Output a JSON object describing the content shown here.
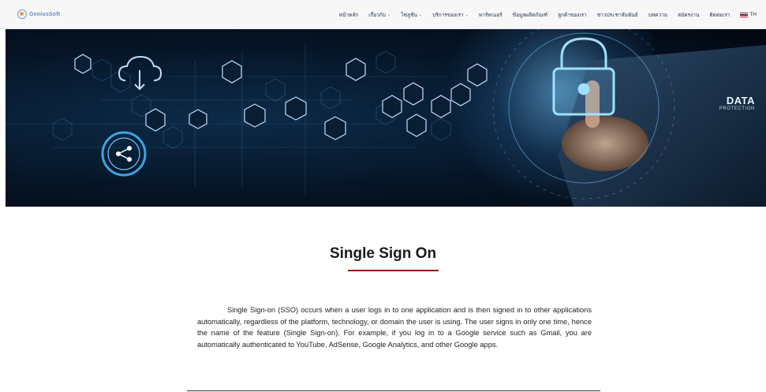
{
  "header": {
    "logo_text": "GeniusSoft",
    "nav": [
      {
        "label": "หน้าหลัก",
        "dropdown": false
      },
      {
        "label": "เกี่ยวกับ",
        "dropdown": true
      },
      {
        "label": "โซลูชั่น",
        "dropdown": true
      },
      {
        "label": "บริการของเรา",
        "dropdown": true
      },
      {
        "label": "พาร์ทเนอร์",
        "dropdown": false
      },
      {
        "label": "ข้อมูลผลิตภัณฑ์",
        "dropdown": false
      },
      {
        "label": "ลูกค้าของเรา",
        "dropdown": false
      },
      {
        "label": "ข่าวประชาสัมพันธ์",
        "dropdown": false
      },
      {
        "label": "บทความ",
        "dropdown": false
      },
      {
        "label": "สมัครงาน",
        "dropdown": false
      },
      {
        "label": "ติดต่อเรา",
        "dropdown": false
      }
    ],
    "language": "TH",
    "dropdown_caret": "⌄"
  },
  "hero": {
    "badge_title": "DATA",
    "badge_subtitle": "PROTECTION",
    "icons": [
      "folder-icon",
      "cloud-download-icon",
      "laptop-icon",
      "phone-call-icon",
      "document-icon",
      "server-icon",
      "video-icon",
      "mail-icon",
      "cloud-upload-icon",
      "browser-icon",
      "globe-icon",
      "lightbulb-icon",
      "bank-icon",
      "gear-icon",
      "share-icon",
      "lock-icon"
    ]
  },
  "content": {
    "title": "Single Sign On",
    "paragraph": "Single Sign-on (SSO) occurs when a user logs in to one application and is then signed in to other applications automatically, regardless of the platform, technology, or domain the user is using. The user signs in only one time, hence the name of the feature (Single Sign-on). For example, if you log in to a Google service such as Gmail, you are automatically authenticated to YouTube, AdSense, Google Analytics, and other Google apps."
  },
  "colors": {
    "accent_underline": "#8b1a1a",
    "nav_text": "#1e2c4d",
    "hero_line": "#3fa3e0"
  }
}
